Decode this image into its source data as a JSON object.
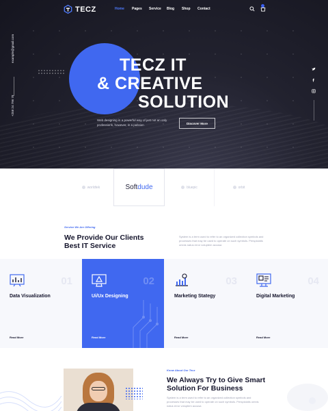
{
  "nav": {
    "logo": "TECZ",
    "menu": [
      "Home",
      "Pages",
      "Service",
      "Blog",
      "Shop",
      "Contact"
    ],
    "active": "Home"
  },
  "hero": {
    "email": "example@gmail.com",
    "phone": "+258 24 796 78",
    "title_line1": "TECZ IT",
    "title_line2": "& CREATIVE",
    "title_line3": "SOLUTION",
    "description": "Web designing in a powerful way of just not an only professions, however, in a passion",
    "button": "Discover More",
    "socials": [
      "twitter-icon",
      "facebook-icon",
      "instagram-icon"
    ]
  },
  "brands": {
    "b0": "worldtek",
    "b1_a": "Soft",
    "b1_b": "dude",
    "b2": "bluepic",
    "b3": "orbit"
  },
  "services": {
    "tag": "Service We Are Offering",
    "title": "We Provide Our Clients Best IT Service",
    "description": "System is a term used to refer to an organized collection symbols and processes that may be used to operate on such symbols. Perspiciatis omnis natus error voluptem accusa",
    "cards": [
      {
        "num": "01",
        "title": "Data Visualization",
        "link": "Read More"
      },
      {
        "num": "02",
        "title": "Ui/Ux Designing",
        "link": "Read More"
      },
      {
        "num": "03",
        "title": "Marketing Stategy",
        "link": "Read More"
      },
      {
        "num": "04",
        "title": "Digital Marketing",
        "link": "Read More"
      }
    ]
  },
  "about": {
    "tag": "Know About Our Tecz",
    "title": "We Always Try to Give Smart Solution For Business",
    "description": "System is a term used to refer to an organized collection symbols and processes that may be used to operate on such symbols. Perspiciatis omnis natus error voluptem accusa"
  },
  "colors": {
    "accent": "#4068f0",
    "hero_bg": "#1c1c28",
    "dark_text": "#14142b"
  }
}
